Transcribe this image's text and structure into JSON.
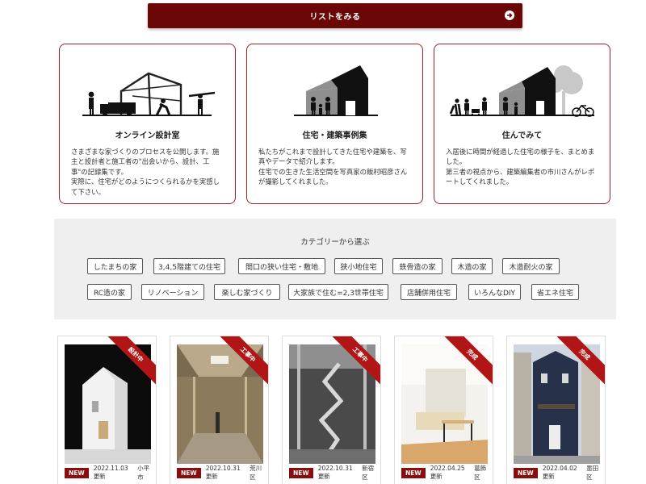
{
  "list_button": {
    "label": "リストをみる",
    "icon": "arrow-right-circle-icon",
    "color": "#6b0707"
  },
  "feature_cards": [
    {
      "title": "オンライン設計室",
      "description": "さまざまな家づくりのプロセスを公開します。施主と設計者と施工者の\"出会いから、設計、工事\"の記録集です。\n実際に、住宅がどのようにつくられるかを実感して下さい。",
      "icon": "construction-illustration"
    },
    {
      "title": "住宅・建築事例集",
      "description": "私たちがこれまで設計してきた住宅や建築を、写真やデータで紹介します。\n住宅での生きた生活空間を写真家の飯村昭彦さんが撮影してくれました。",
      "icon": "house-family-illustration"
    },
    {
      "title": "住んでみて",
      "description": "入居後に時間が経過した住宅の様子を、まとめました。\n第三者の視点から、建築編集者の市川さんがレポートしてくれました。",
      "icon": "neighborhood-illustration"
    }
  ],
  "categories": {
    "title": "カテゴリーから選ぶ",
    "row1": [
      "したまちの家",
      "3,4,5階建ての住宅",
      "間口の狭い住宅・敷地",
      "狭小地住宅",
      "鉄骨造の家",
      "木造の家",
      "木造耐火の家"
    ],
    "row2": [
      "RC造の家",
      "リノベーション",
      "楽しむ家づくり",
      "大家族で住む=2,3世帯住宅",
      "店舗併用住宅",
      "いろんなDIY",
      "省エネ住宅"
    ]
  },
  "projects": [
    {
      "status": "設計中",
      "new": "NEW",
      "date": "2022.11.03更新",
      "area": "小平市"
    },
    {
      "status": "工事中",
      "new": "NEW",
      "date": "2022.10.31更新",
      "area": "荒川区"
    },
    {
      "status": "工事中",
      "new": "NEW",
      "date": "2022.10.31更新",
      "area": "新宿区"
    },
    {
      "status": "完成",
      "new": "NEW",
      "date": "2022.04.25更新",
      "area": "葛飾区"
    },
    {
      "status": "完成",
      "new": "NEW",
      "date": "2022.04.02更新",
      "area": "墨田区"
    }
  ],
  "colors": {
    "accent": "#6b0707",
    "ribbon": "#b11515",
    "card_border": "#a62020",
    "panel_bg": "#efefef"
  }
}
